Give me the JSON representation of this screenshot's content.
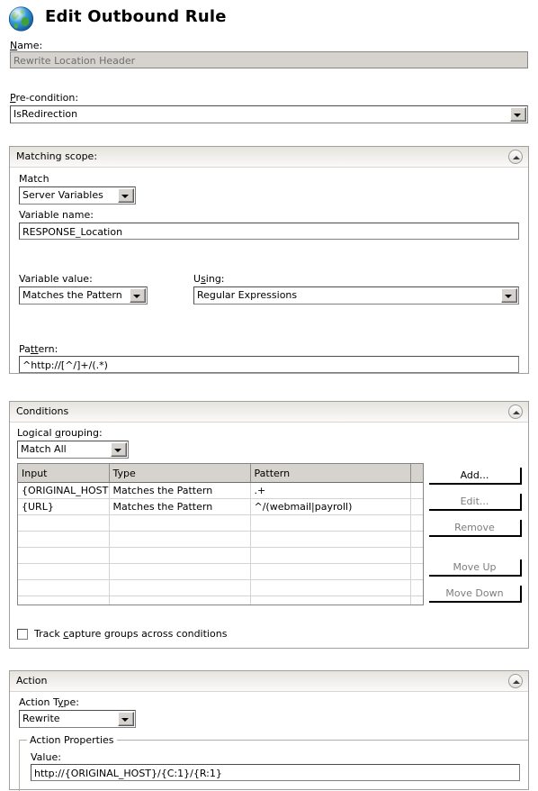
{
  "window": {
    "title": "Edit Outbound Rule",
    "icon": "globe-icon"
  },
  "name_field": {
    "label": "Name:",
    "label_accel": "N",
    "value": "Rewrite Location Header",
    "disabled": true
  },
  "precondition_field": {
    "label": "Pre-condition:",
    "label_accel": "P",
    "value": "IsRedirection"
  },
  "matching_scope": {
    "title": "Matching scope:",
    "collapse_icon": "chevron-up-icon",
    "match_label": "Match",
    "match_value": "Server Variables",
    "variable_name_label": "Variable name:",
    "variable_name_value": "RESPONSE_Location",
    "variable_value_label": "Variable value:",
    "variable_value_value": "Matches the Pattern",
    "using_label": "Using:",
    "using_accel": "s",
    "using_value": "Regular Expressions",
    "pattern_label": "Pattern:",
    "pattern_accel": "tt",
    "pattern_value": "^http://[^/]+/(.*)"
  },
  "conditions": {
    "title": "Conditions",
    "collapse_icon": "chevron-up-icon",
    "logical_grouping_label": "Logical grouping:",
    "logical_grouping_accel": "g",
    "logical_grouping_value": "Match All",
    "columns": [
      "Input",
      "Type",
      "Pattern",
      ""
    ],
    "rows": [
      {
        "input": "{ORIGINAL_HOST}",
        "type": "Matches the Pattern",
        "pattern": ".+",
        "extra": ""
      },
      {
        "input": "{URL}",
        "type": "Matches the Pattern",
        "pattern": "^/(webmail|payroll)",
        "extra": ""
      }
    ],
    "empty_row_count": 8,
    "buttons": [
      {
        "label": "Add...",
        "enabled": true
      },
      {
        "label": "Edit...",
        "enabled": false
      },
      {
        "label": "Remove",
        "enabled": false
      },
      {
        "label": "Move Up",
        "enabled": false
      },
      {
        "label": "Move Down",
        "enabled": false
      }
    ],
    "track_checkbox_label": "Track capture groups across conditions",
    "track_checkbox_accel": "c",
    "track_checkbox_checked": false
  },
  "action": {
    "title": "Action",
    "collapse_icon": "chevron-up-icon",
    "action_type_label": "Action Type:",
    "action_type_accel": "y",
    "action_type_value": "Rewrite",
    "properties_group_title": "Action Properties",
    "value_label": "Value:",
    "value_value": "http://{ORIGINAL_HOST}/{C:1}/{R:1}"
  }
}
